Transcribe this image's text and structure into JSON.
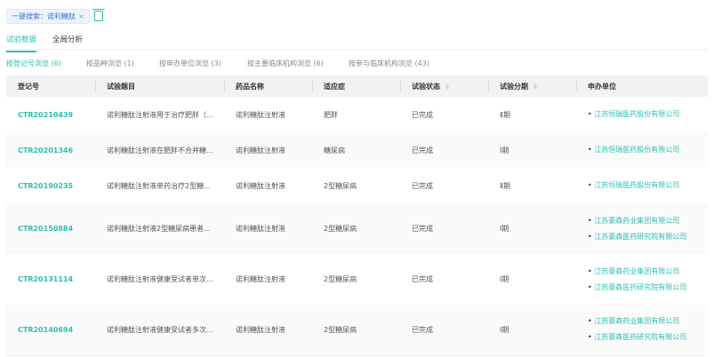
{
  "search_tag": {
    "label": "一键搜索：诺利糖肽",
    "close": "×"
  },
  "tabs": [
    "试验数据",
    "全局分析"
  ],
  "subtabs": [
    "按登记号浏览 (6)",
    "按品种浏览 (1)",
    "按申办单位浏览 (3)",
    "按主要临床机构浏览 (6)",
    "按参与临床机构浏览 (43)"
  ],
  "columns": [
    "登记号",
    "试验题目",
    "药品名称",
    "适应症",
    "试验状态",
    "试验分期",
    "申办单位"
  ],
  "rows": [
    {
      "reg": "CTR20210439",
      "title": "诺利糖肽注射液用于治疗肥胖（...",
      "drug": "诺利糖肽注射液",
      "ind": "肥胖",
      "status": "已完成",
      "phase": "Ⅱ期",
      "sponsors": [
        "江苏恒瑞医药股份有限公司"
      ]
    },
    {
      "reg": "CTR20201346",
      "title": "诺利糖肽注射液在肥胖不合并糖...",
      "drug": "诺利糖肽注射液",
      "ind": "糖尿病",
      "status": "已完成",
      "phase": "Ⅰ期",
      "sponsors": [
        "江苏恒瑞医药股份有限公司"
      ]
    },
    {
      "reg": "CTR20190235",
      "title": "诺利糖肽注射液单药治疗2型糖...",
      "drug": "诺利糖肽注射液",
      "ind": "2型糖尿病",
      "status": "已完成",
      "phase": "Ⅱ期",
      "sponsors": [
        "江苏恒瑞医药股份有限公司"
      ]
    },
    {
      "reg": "CTR20150884",
      "title": "诺利糖肽注射液2型糖尿病患者...",
      "drug": "诺利糖肽注射液",
      "ind": "2型糖尿病",
      "status": "已完成",
      "phase": "Ⅰ期",
      "sponsors": [
        "江苏豪森药业集团有限公司",
        "江苏豪森医药研究院有限公司"
      ]
    },
    {
      "reg": "CTR20131114",
      "title": "诺利糖肽注射液健康受试者单次...",
      "drug": "诺利糖肽注射液",
      "ind": "2型糖尿病",
      "status": "已完成",
      "phase": "Ⅰ期",
      "sponsors": [
        "江苏豪森药业集团有限公司",
        "江苏豪森医药研究院有限公司"
      ]
    },
    {
      "reg": "CTR20140694",
      "title": "诺利糖肽注射液健康受试者多次...",
      "drug": "诺利糖肽注射液",
      "ind": "2型糖尿病",
      "status": "已完成",
      "phase": "Ⅰ期",
      "sponsors": [
        "江苏豪森药业集团有限公司",
        "江苏豪森医药研究院有限公司"
      ]
    }
  ]
}
